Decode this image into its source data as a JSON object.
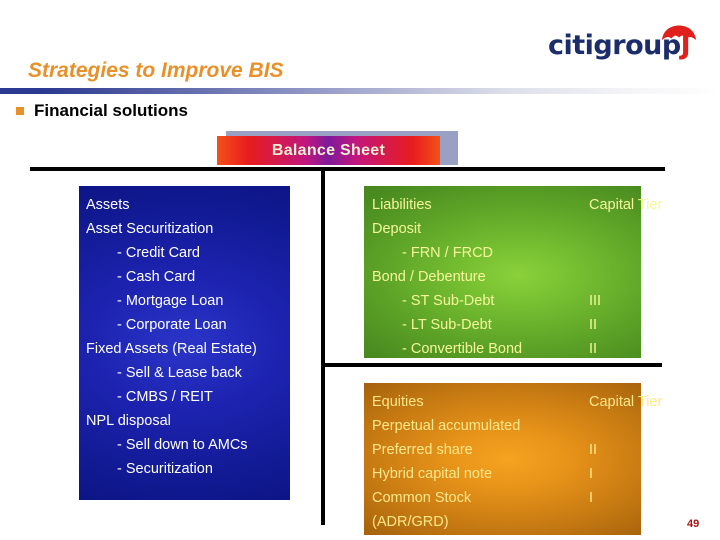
{
  "logo": {
    "text_primary": "citigroup",
    "text_accent": "J",
    "umbrella_icon": "umbrella-icon",
    "color_text": "#1b2d6b",
    "color_accent": "#e0201b"
  },
  "header": {
    "title": "Strategies to Improve BIS",
    "title_color": "#e8912b",
    "bullet": "Financial solutions",
    "bullet_marker_color": "#e8912b"
  },
  "banner": {
    "label": "Balance Sheet",
    "text_color": "#f7efd2",
    "shadow_color": "#9aa0c4"
  },
  "panels": {
    "assets": {
      "name": "Assets",
      "accent_color": "#111a93",
      "text_color": "#ffffff",
      "rows": [
        {
          "label": "Assets",
          "indent": false
        },
        {
          "label": "Asset Securitization",
          "indent": false
        },
        {
          "label": "- Credit Card",
          "indent": true
        },
        {
          "label": "- Cash Card",
          "indent": true
        },
        {
          "label": "- Mortgage Loan",
          "indent": true
        },
        {
          "label": "- Corporate Loan",
          "indent": true
        },
        {
          "label": "Fixed Assets (Real Estate)",
          "indent": false
        },
        {
          "label": "- Sell & Lease back",
          "indent": true
        },
        {
          "label": "- CMBS / REIT",
          "indent": true
        },
        {
          "label": "NPL disposal",
          "indent": false
        },
        {
          "label": "- Sell down to AMCs",
          "indent": true
        },
        {
          "label": "- Securitization",
          "indent": true
        }
      ]
    },
    "liabilities": {
      "name": "Liabilities",
      "tier_header": "Capital Tier",
      "accent_color": "#5da327",
      "text_color": "#f5f79a",
      "rows": [
        {
          "label": "Liabilities",
          "indent": false,
          "tier": ""
        },
        {
          "label": "Deposit",
          "indent": false,
          "tier": ""
        },
        {
          "label": "- FRN / FRCD",
          "indent": true,
          "tier": ""
        },
        {
          "label": "Bond / Debenture",
          "indent": false,
          "tier": ""
        },
        {
          "label": "- ST Sub-Debt",
          "indent": true,
          "tier": "III"
        },
        {
          "label": "- LT Sub-Debt",
          "indent": true,
          "tier": "II"
        },
        {
          "label": "- Convertible Bond",
          "indent": true,
          "tier": "II"
        }
      ]
    },
    "equities": {
      "name": "Equities",
      "tier_header": "Capital Tier",
      "accent_color": "#c87b12",
      "text_color": "#ffe88a",
      "rows": [
        {
          "label": "Equities",
          "indent": false,
          "tier": ""
        },
        {
          "label": "Perpetual accumulated",
          "indent": false,
          "tier": ""
        },
        {
          "label": "Preferred share",
          "indent": false,
          "tier": "II"
        },
        {
          "label": "Hybrid capital note",
          "indent": false,
          "tier": "I"
        },
        {
          "label": "Common Stock",
          "indent": false,
          "tier": "I"
        },
        {
          "label": "(ADR/GRD)",
          "indent": false,
          "tier": ""
        }
      ]
    }
  },
  "footer": {
    "page_number": "49"
  }
}
